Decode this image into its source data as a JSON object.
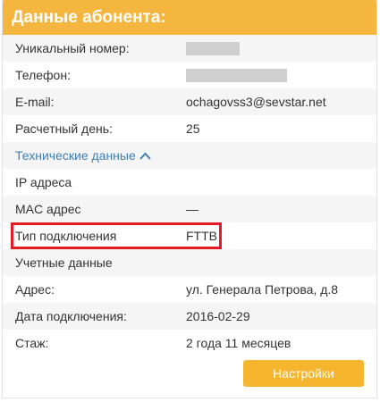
{
  "panel": {
    "title": "Данные абонента:"
  },
  "fields": {
    "unique_number_label": "Уникальный номер:",
    "phone_label": "Телефон:",
    "email_label": "E-mail:",
    "email_value": "ochagovss3@sevstar.net",
    "billing_day_label": "Расчетный день:",
    "billing_day_value": "25",
    "tech_toggle_label": "Технические данные",
    "ip_label": "IP адреса",
    "mac_label": "MAC адрес",
    "mac_value": "—",
    "connection_type_label": "Тип подключения",
    "connection_type_value": "FTTB",
    "credentials_label": "Учетные данные",
    "address_label": "Адрес:",
    "address_value": "ул. Генерала Петрова, д.8",
    "connection_date_label": "Дата подключения:",
    "connection_date_value": "2016-02-29",
    "tenure_label": "Стаж:",
    "tenure_value": "2 года 11 месяцев"
  },
  "actions": {
    "settings_label": "Настройки"
  },
  "colors": {
    "header": "#f4b63f",
    "button": "#f6b52e",
    "link": "#3e7fb6",
    "highlight": "#e21b24"
  },
  "icons": {
    "toggle": "chevron-up-icon"
  }
}
